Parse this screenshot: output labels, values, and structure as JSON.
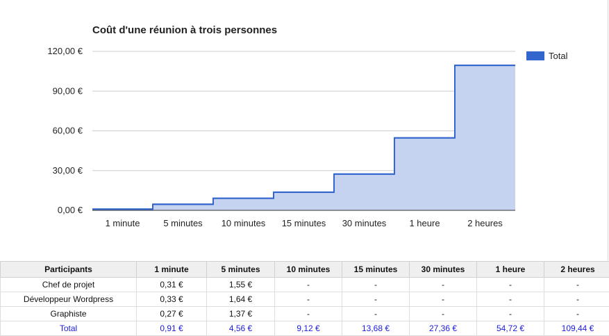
{
  "chart_data": {
    "type": "area",
    "step": true,
    "title": "Coût d'une réunion à trois personnes",
    "categories": [
      "1 minute",
      "5 minutes",
      "10 minutes",
      "15 minutes",
      "30 minutes",
      "1 heure",
      "2 heures"
    ],
    "series": [
      {
        "name": "Total",
        "values": [
          0.91,
          4.56,
          9.12,
          13.68,
          27.36,
          54.72,
          109.44
        ]
      }
    ],
    "ylim": [
      0,
      120
    ],
    "yticks": [
      "0,00 €",
      "30,00 €",
      "60,00 €",
      "90,00 €",
      "120,00 €"
    ],
    "ytick_values": [
      0,
      30,
      60,
      90,
      120
    ],
    "grid": true,
    "legend": "right",
    "colors": {
      "line": "#3366cc",
      "fill": "#c5d3f0",
      "grid": "#cccccc",
      "axis": "#333333"
    }
  },
  "table": {
    "headers": [
      "Participants",
      "1 minute",
      "5 minutes",
      "10 minutes",
      "15 minutes",
      "30 minutes",
      "1 heure",
      "2 heures"
    ],
    "rows": [
      [
        "Chef de projet",
        "0,31 €",
        "1,55 €",
        "-",
        "-",
        "-",
        "-",
        "-"
      ],
      [
        "Développeur Wordpress",
        "0,33 €",
        "1,64 €",
        "-",
        "-",
        "-",
        "-",
        "-"
      ],
      [
        "Graphiste",
        "0,27 €",
        "1,37 €",
        "-",
        "-",
        "-",
        "-",
        "-"
      ]
    ],
    "total": [
      "Total",
      "0,91 €",
      "4,56 €",
      "9,12 €",
      "13,68 €",
      "27,36 €",
      "54,72 €",
      "109,44 €"
    ]
  }
}
